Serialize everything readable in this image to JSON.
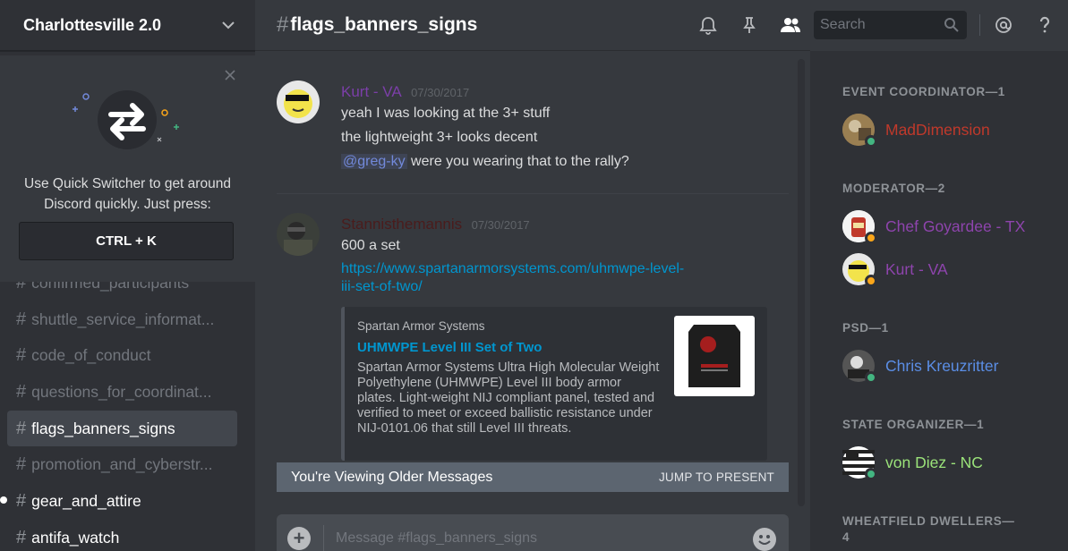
{
  "guild": {
    "name": "Charlottesville 2.0"
  },
  "quick_switcher": {
    "text_line1": "Use Quick Switcher to get around",
    "text_line2": "Discord quickly. Just press:",
    "shortcut": "CTRL + K"
  },
  "channels": [
    {
      "name": "confirmed_participants",
      "state": "muted"
    },
    {
      "name": "shuttle_service_informat...",
      "state": "muted"
    },
    {
      "name": "code_of_conduct",
      "state": "muted"
    },
    {
      "name": "questions_for_coordinat...",
      "state": "muted"
    },
    {
      "name": "flags_banners_signs",
      "state": "active"
    },
    {
      "name": "promotion_and_cyberstr...",
      "state": "muted"
    },
    {
      "name": "gear_and_attire",
      "state": "unread"
    },
    {
      "name": "antifa_watch",
      "state": "unread"
    }
  ],
  "header": {
    "channel_name": "flags_banners_signs",
    "search_placeholder": "Search"
  },
  "messages": [
    {
      "author": "Kurt - VA",
      "author_color": "#7b3fa8",
      "timestamp": "07/30/2017",
      "lines": [
        "yeah I was looking at the 3+ stuff",
        "the lightweight 3+ looks decent"
      ],
      "mention": "@greg-ky",
      "mention_tail": " were you wearing that to the rally?"
    },
    {
      "author": "Stannisthemannis",
      "author_color": "#4a1c1c",
      "timestamp": "07/30/2017",
      "text": "600 a set",
      "link_line1": "https://www.spartanarmorsystems.com/uhmwpe-level-",
      "link_line2": "iii-set-of-two/",
      "embed": {
        "provider": "Spartan Armor Systems",
        "title": "UHMWPE Level III Set of Two",
        "description": "Spartan Armor Systems Ultra High Molecular Weight Polyethylene (UHMWPE) Level III body armor plates. Light-weight NIJ compliant panel, tested and verified to meet or exceed ballistic resistance under NIJ-0101.06 that still Level III threats."
      }
    }
  ],
  "older_bar": {
    "text": "You're Viewing Older Messages",
    "jump": "JUMP TO PRESENT"
  },
  "composer": {
    "placeholder": "Message #flags_banners_signs"
  },
  "members": {
    "roles": [
      {
        "header": "EVENT COORDINATOR—1",
        "members": [
          {
            "name": "MadDimension",
            "color": "#c0392b",
            "status": "online"
          }
        ]
      },
      {
        "header": "MODERATOR—2",
        "members": [
          {
            "name": "Chef Goyardee - TX",
            "color": "#8e44ad",
            "status": "idle"
          },
          {
            "name": "Kurt - VA",
            "color": "#8e44ad",
            "status": "idle"
          }
        ]
      },
      {
        "header": "PSD—1",
        "members": [
          {
            "name": "Chris Kreuzritter",
            "color": "#5b8ee6",
            "status": "online"
          }
        ]
      },
      {
        "header": "STATE ORGANIZER—1",
        "members": [
          {
            "name": "von Diez - NC",
            "color": "#9be37a",
            "status": "online"
          }
        ]
      },
      {
        "header": "WHEATFIELD DWELLERS—4",
        "members": []
      }
    ]
  },
  "colors": {
    "online": "#43b581",
    "idle": "#faa61a",
    "link": "#0096cf"
  }
}
